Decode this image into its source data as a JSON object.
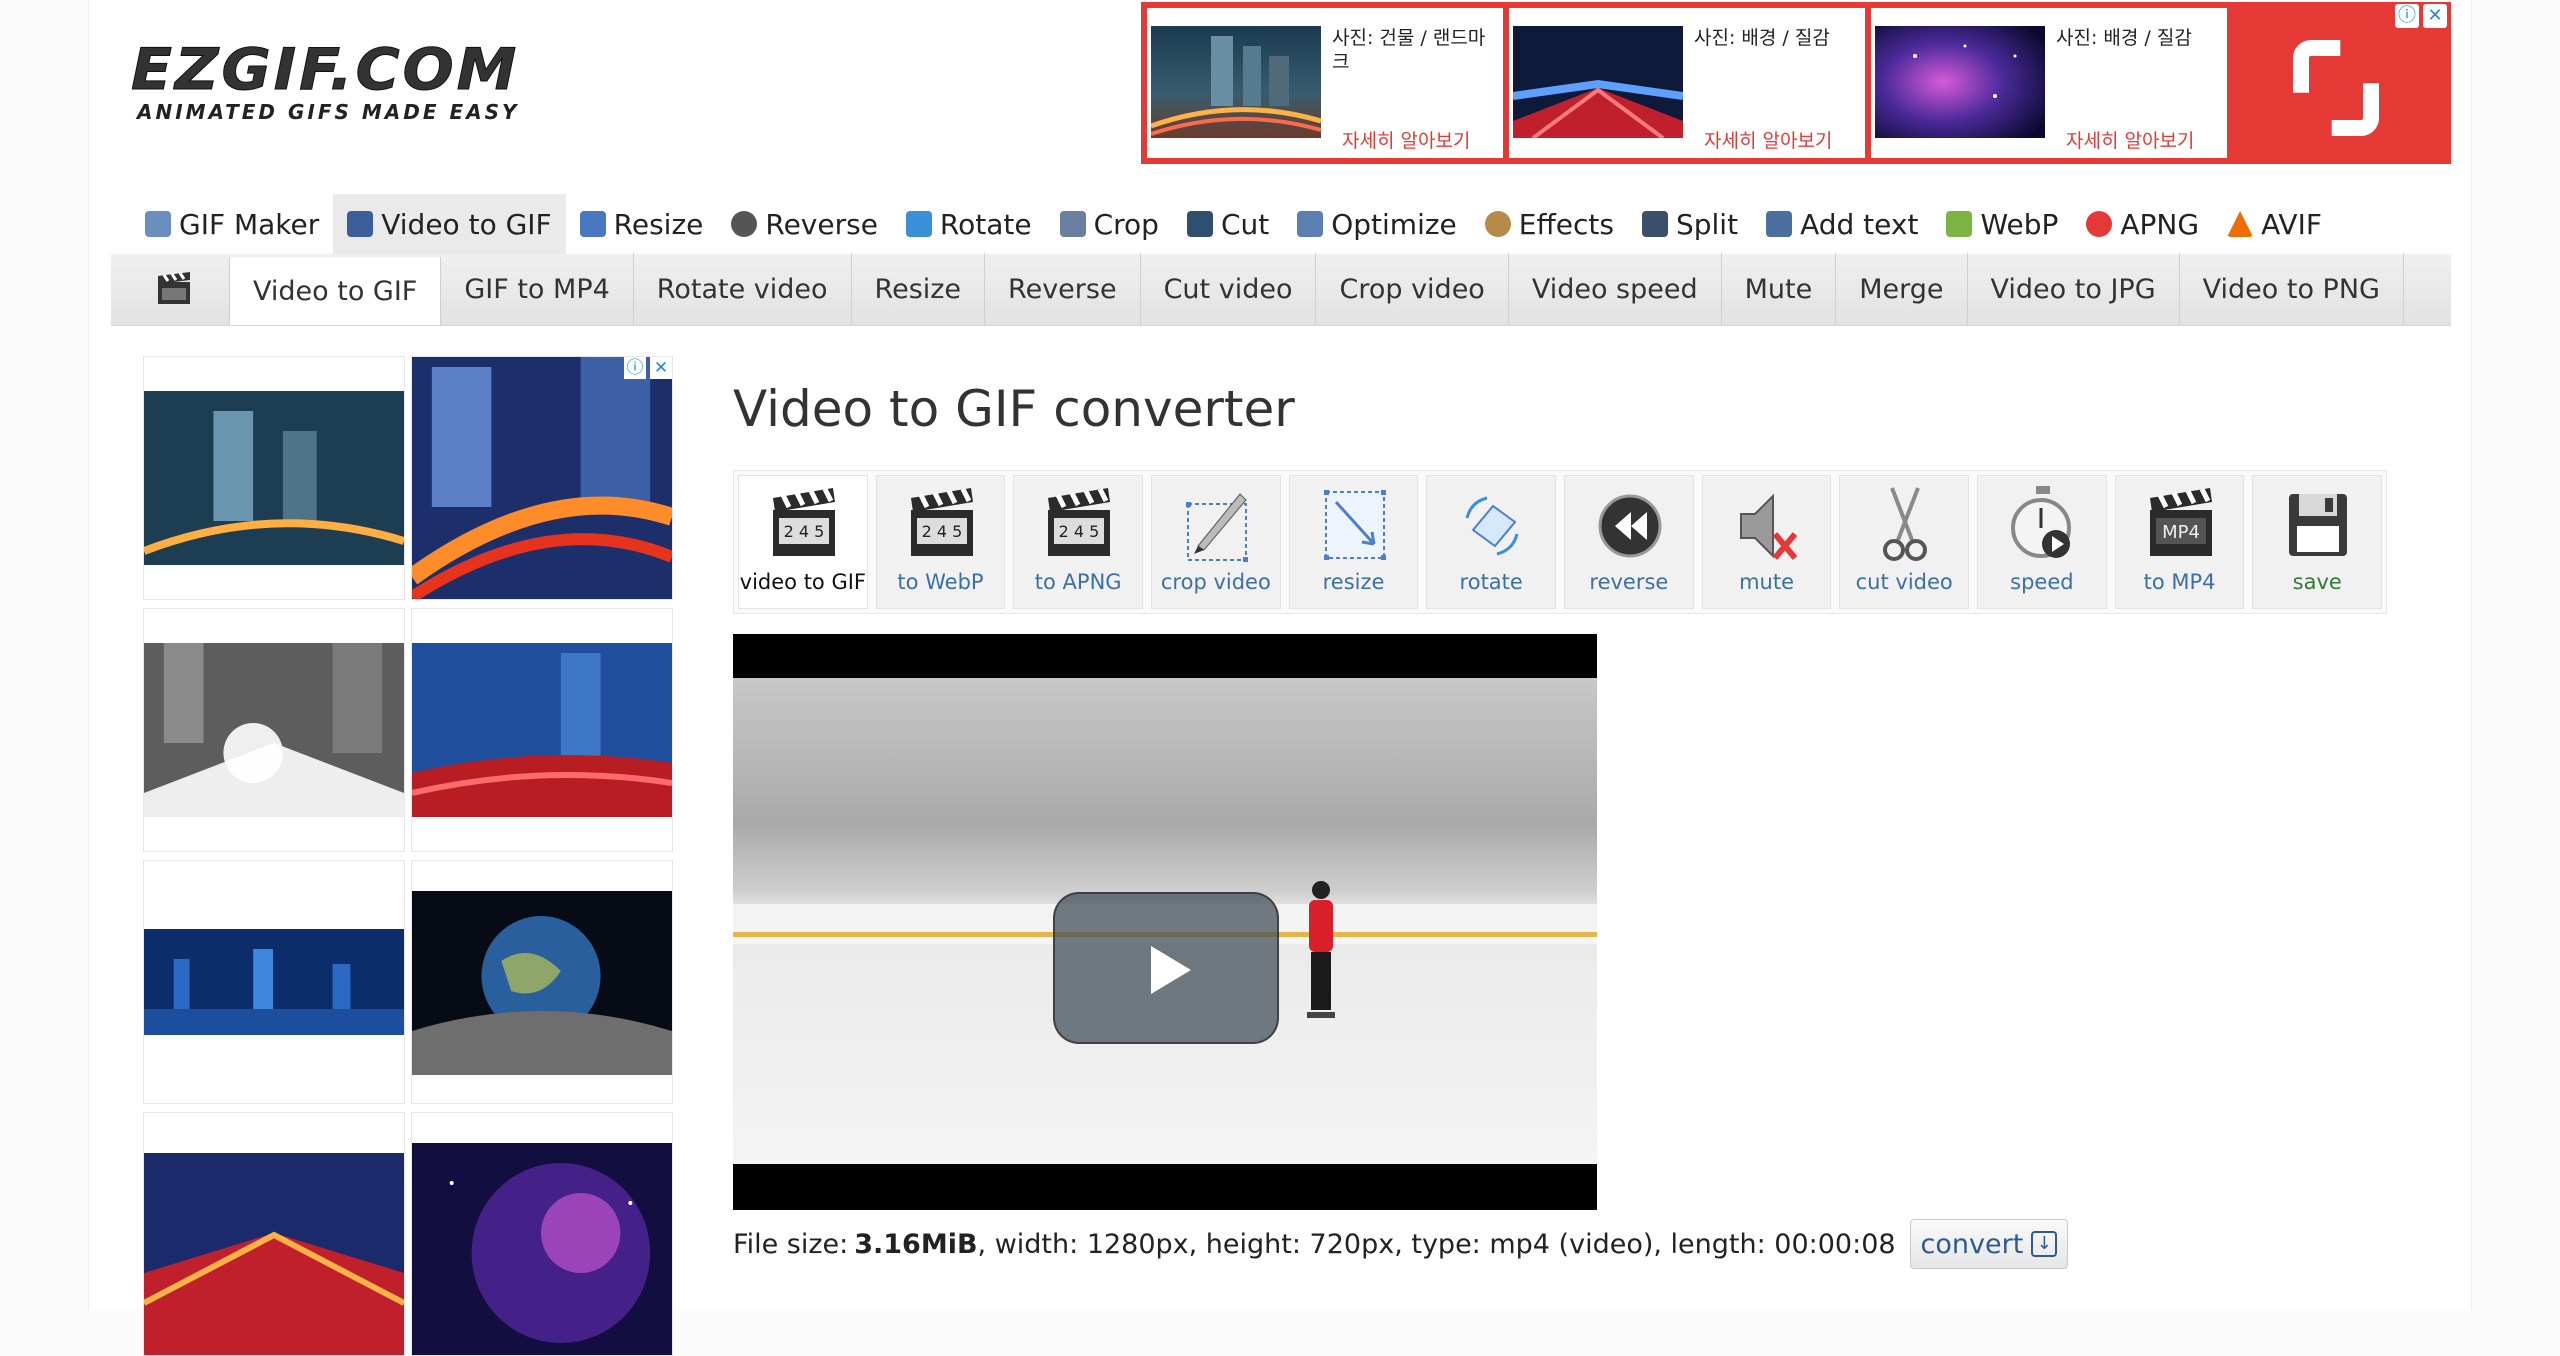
{
  "logo": {
    "main": "EZGIF.COM",
    "tagline": "ANIMATED GIFS MADE EASY"
  },
  "top_ad": {
    "cards": [
      {
        "caption": "사진: 건물 / 랜드마크",
        "more": "자세히 알아보기"
      },
      {
        "caption": "사진: 배경 / 질감",
        "more": "자세히 알아보기"
      },
      {
        "caption": "사진: 배경 / 질감",
        "more": "자세히 알아보기"
      }
    ],
    "info_icon": "ⓘ",
    "close_icon": "✕"
  },
  "main_nav": [
    {
      "label": "GIF Maker",
      "icon": "gif-maker-icon",
      "color": "#6a8fbf"
    },
    {
      "label": "Video to GIF",
      "icon": "film-icon",
      "color": "#3a5f9a",
      "active": true
    },
    {
      "label": "Resize",
      "icon": "resize-icon",
      "color": "#4a78c0"
    },
    {
      "label": "Reverse",
      "icon": "reverse-icon",
      "color": "#555555"
    },
    {
      "label": "Rotate",
      "icon": "rotate-icon",
      "color": "#3a8fd8"
    },
    {
      "label": "Crop",
      "icon": "crop-icon",
      "color": "#6a7fa0"
    },
    {
      "label": "Cut",
      "icon": "cut-icon",
      "color": "#2f4f6f"
    },
    {
      "label": "Optimize",
      "icon": "optimize-icon",
      "color": "#5a7fb0"
    },
    {
      "label": "Effects",
      "icon": "effects-icon",
      "color": "#b58a4a"
    },
    {
      "label": "Split",
      "icon": "split-icon",
      "color": "#3a4f6a"
    },
    {
      "label": "Add text",
      "icon": "add-text-icon",
      "color": "#4a6fa0"
    },
    {
      "label": "WebP",
      "icon": "webp-icon",
      "color": "#7cb342"
    },
    {
      "label": "APNG",
      "icon": "apng-icon",
      "color": "#e53935"
    },
    {
      "label": "AVIF",
      "icon": "avif-icon",
      "color": "#ef6c00"
    }
  ],
  "sub_nav": {
    "icon": "clapperboard-icon",
    "tabs": [
      "Video to GIF",
      "GIF to MP4",
      "Rotate video",
      "Resize",
      "Reverse",
      "Cut video",
      "Crop video",
      "Video speed",
      "Mute",
      "Merge",
      "Video to JPG",
      "Video to PNG"
    ],
    "active_index": 0
  },
  "side_ad": {
    "info_icon": "ⓘ",
    "close_icon": "✕"
  },
  "page_title": "Video to GIF converter",
  "tools": [
    {
      "label": "video to GIF",
      "icon": "clapperboard-icon",
      "active": true
    },
    {
      "label": "to WebP",
      "icon": "clapperboard-icon"
    },
    {
      "label": "to APNG",
      "icon": "clapperboard-icon"
    },
    {
      "label": "crop video",
      "icon": "crop-icon"
    },
    {
      "label": "resize",
      "icon": "resize-icon"
    },
    {
      "label": "rotate",
      "icon": "rotate-icon"
    },
    {
      "label": "reverse",
      "icon": "rewind-icon"
    },
    {
      "label": "mute",
      "icon": "mute-icon"
    },
    {
      "label": "cut video",
      "icon": "scissors-icon"
    },
    {
      "label": "speed",
      "icon": "stopwatch-icon"
    },
    {
      "label": "to MP4",
      "icon": "mp4-icon"
    },
    {
      "label": "save",
      "icon": "floppy-disk-icon"
    }
  ],
  "clap_digits": "2 4 5",
  "mp4_text": "MP4",
  "file_info": {
    "prefix": "File size:",
    "size": "3.16MiB",
    "rest": ", width: 1280px, height: 720px, type: mp4 (video), length: 00:00:08",
    "convert_label": "convert"
  }
}
